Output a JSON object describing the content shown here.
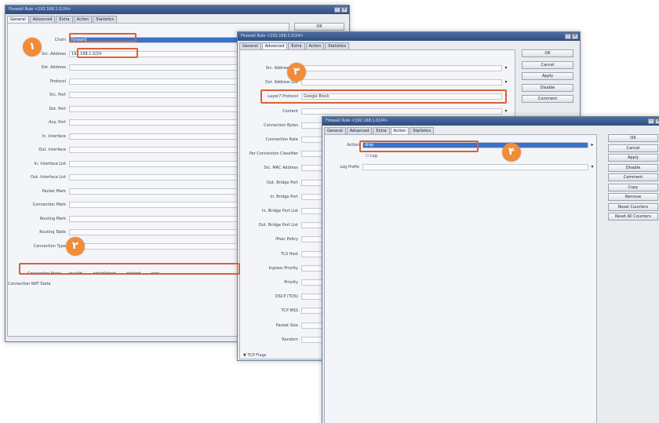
{
  "windows": {
    "w1": {
      "title": "Firewall Rule <192.168.1.0/24>",
      "tabs": [
        "General",
        "Advanced",
        "Extra",
        "Action",
        "Statistics"
      ],
      "fields": [
        {
          "label": "Chain",
          "value": "forward"
        },
        {
          "label": "Src. Address",
          "value": "192.168.1.0/24"
        },
        {
          "label": "Dst. Address",
          "value": ""
        },
        {
          "label": "Protocol",
          "value": ""
        },
        {
          "label": "Src. Port",
          "value": ""
        },
        {
          "label": "Dst. Port",
          "value": ""
        },
        {
          "label": "Any. Port",
          "value": ""
        },
        {
          "label": "In. Interface",
          "value": ""
        },
        {
          "label": "Out. Interface",
          "value": ""
        },
        {
          "label": "In. Interface List",
          "value": ""
        },
        {
          "label": "Out. Interface List",
          "value": ""
        },
        {
          "label": "Packet Mark",
          "value": ""
        },
        {
          "label": "Connection Mark",
          "value": ""
        },
        {
          "label": "Routing Mark",
          "value": ""
        },
        {
          "label": "Routing Table",
          "value": ""
        },
        {
          "label": "Connection Type",
          "value": ""
        }
      ],
      "conn_state_label": "Connection State",
      "conn_states": [
        "invalid",
        "established",
        "related",
        "new"
      ],
      "conn_nat_label": "Connection NAT State",
      "buttons": [
        "OK"
      ]
    },
    "w2": {
      "title": "Firewall Rule <192.168.1.0/24>",
      "tabs": [
        "General",
        "Advanced",
        "Extra",
        "Action",
        "Statistics"
      ],
      "fields": [
        {
          "label": "Src. Address List",
          "value": ""
        },
        {
          "label": "Dst. Address List",
          "value": ""
        },
        {
          "label": "Layer7 Protocol",
          "value": "Google Block"
        },
        {
          "label": "Content",
          "value": ""
        },
        {
          "label": "Connection Bytes",
          "value": ""
        },
        {
          "label": "Connection Rate",
          "value": ""
        },
        {
          "label": "Per Connection Classifier",
          "value": ""
        },
        {
          "label": "Src. MAC Address",
          "value": ""
        },
        {
          "label": "Out. Bridge Port",
          "value": ""
        },
        {
          "label": "In. Bridge Port",
          "value": ""
        },
        {
          "label": "In. Bridge Port List",
          "value": ""
        },
        {
          "label": "Out. Bridge Port List",
          "value": ""
        },
        {
          "label": "IPsec Policy",
          "value": ""
        },
        {
          "label": "TLS Host",
          "value": ""
        },
        {
          "label": "Ingress Priority",
          "value": ""
        },
        {
          "label": "Priority",
          "value": ""
        },
        {
          "label": "DSCP (TOS)",
          "value": ""
        },
        {
          "label": "TCP MSS",
          "value": ""
        },
        {
          "label": "Packet Size",
          "value": ""
        },
        {
          "label": "Random",
          "value": ""
        }
      ],
      "tcp_flags": "TCP Flags",
      "buttons": [
        "OK",
        "Cancel",
        "Apply",
        "Disable",
        "Comment"
      ]
    },
    "w3": {
      "title": "Firewall Rule <192.168.1.0/24>",
      "tabs": [
        "General",
        "Advanced",
        "Extra",
        "Action",
        "Statistics"
      ],
      "action_label": "Action",
      "action_value": "drop",
      "log_label": "Log",
      "log_prefix_label": "Log Prefix",
      "buttons": [
        "OK",
        "Cancel",
        "Apply",
        "Disable",
        "Comment",
        "Copy",
        "Remove",
        "Reset Counters",
        "Reset All Counters"
      ]
    }
  },
  "badges": [
    "١",
    "٢",
    "٣",
    "۴"
  ],
  "colors": {
    "accent": "#ef8d3a",
    "highlight_box": "#d9603a",
    "titlebar": "#3a5c91"
  }
}
